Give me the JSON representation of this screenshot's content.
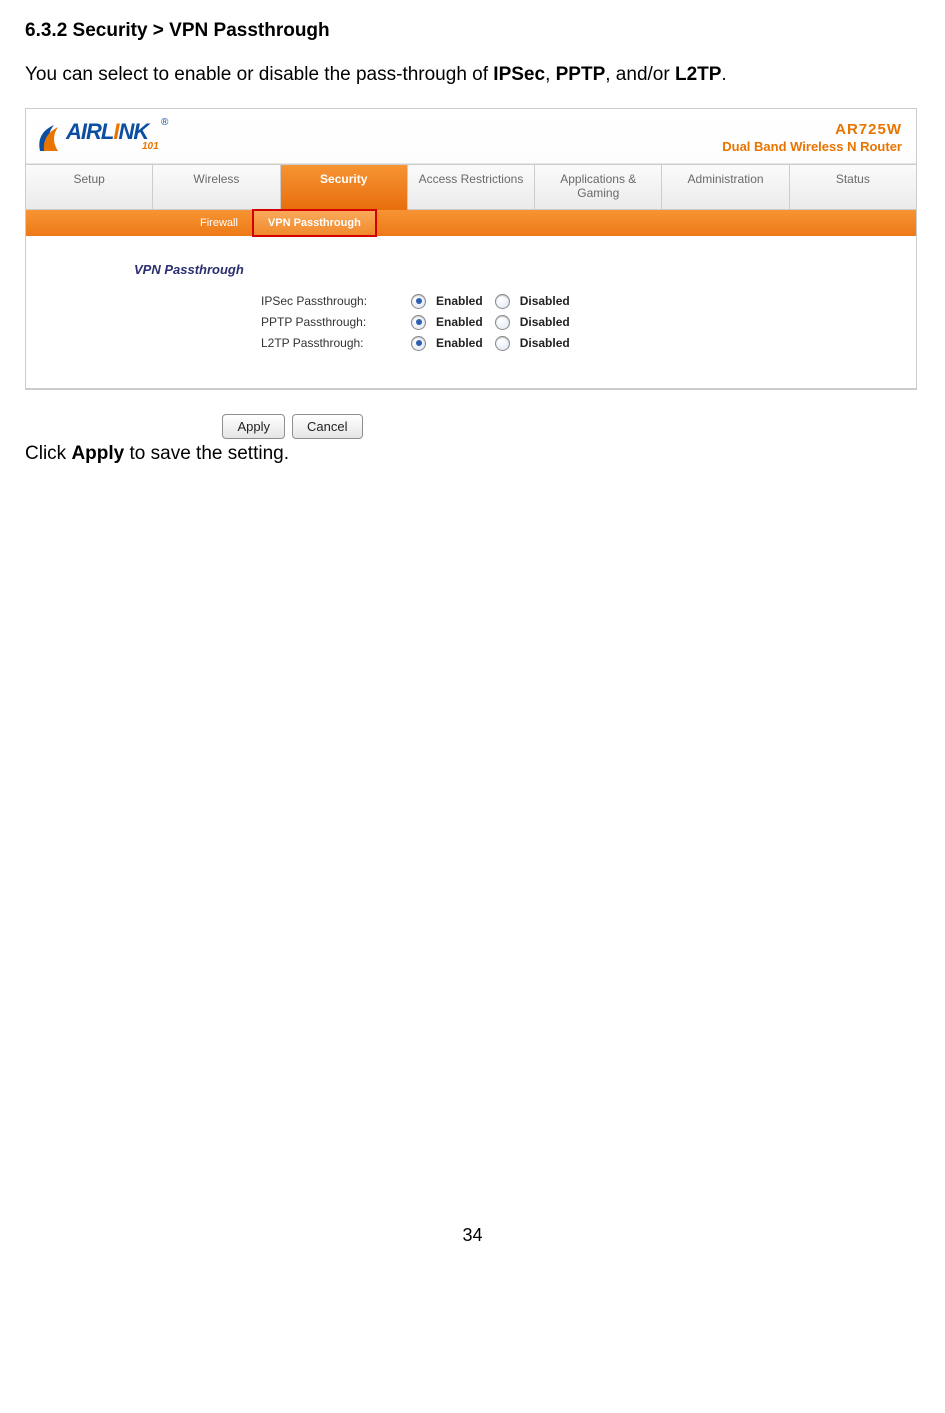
{
  "doc": {
    "section_title": "6.3.2 Security > VPN Passthrough",
    "intro_prefix": "You can select to enable or disable the pass-through of ",
    "intro_b1": "IPSec",
    "intro_sep1": ", ",
    "intro_b2": "PPTP",
    "intro_sep2": ", and/or ",
    "intro_b3": "L2TP",
    "intro_suffix": ".",
    "outro_prefix": "Click ",
    "outro_bold": "Apply",
    "outro_suffix": " to save the setting.",
    "page_number": "34"
  },
  "router": {
    "logo": {
      "prefix": "A",
      "mid": "IRL",
      "i": "I",
      "suffix": "NK",
      "reg": "®",
      "sub": "101"
    },
    "model": {
      "name": "AR725W",
      "desc": "Dual Band Wireless N Router"
    },
    "main_tabs": [
      {
        "label": "Setup",
        "active": false
      },
      {
        "label": "Wireless",
        "active": false
      },
      {
        "label": "Security",
        "active": true
      },
      {
        "label": "Access Restrictions",
        "active": false
      },
      {
        "label": "Applications & Gaming",
        "active": false
      },
      {
        "label": "Administration",
        "active": false
      },
      {
        "label": "Status",
        "active": false
      }
    ],
    "sub_tabs": [
      {
        "label": "Firewall",
        "active": false
      },
      {
        "label": "VPN Passthrough",
        "active": true
      }
    ],
    "section_head": "VPN Passthrough",
    "fields": [
      {
        "label": "IPSec Passthrough:",
        "enabled": "Enabled",
        "disabled": "Disabled",
        "selected": "enabled"
      },
      {
        "label": "PPTP Passthrough:",
        "enabled": "Enabled",
        "disabled": "Disabled",
        "selected": "enabled"
      },
      {
        "label": "L2TP Passthrough:",
        "enabled": "Enabled",
        "disabled": "Disabled",
        "selected": "enabled"
      }
    ],
    "buttons": {
      "apply": "Apply",
      "cancel": "Cancel"
    }
  }
}
